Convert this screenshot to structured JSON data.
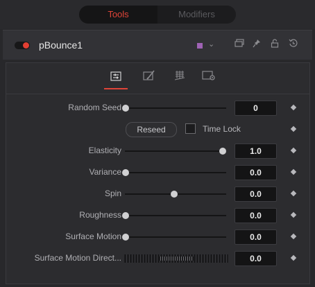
{
  "topbar": {
    "tabs": [
      {
        "label": "Tools",
        "active": true
      },
      {
        "label": "Modifiers",
        "active": false
      }
    ]
  },
  "header": {
    "tool_name": "pBounce1",
    "enabled": true,
    "swatch_color": "#9f63b5",
    "icons": [
      "chevron-down-icon",
      "windows-icon",
      "pin-icon",
      "lock-icon",
      "reset-icon"
    ]
  },
  "panel": {
    "tabs": [
      {
        "name": "controls-tab",
        "icon": "sliders-icon",
        "active": true
      },
      {
        "name": "style-tab",
        "icon": "brush-icon",
        "active": false
      },
      {
        "name": "region-tab",
        "icon": "grid-icon",
        "active": false
      },
      {
        "name": "settings-tab",
        "icon": "gear-icon",
        "active": false
      }
    ],
    "random_seed": {
      "label": "Random Seed",
      "value": "0",
      "level": 0.0
    },
    "reseed": {
      "label": "Reseed"
    },
    "time_lock": {
      "label": "Time Lock",
      "checked": false
    },
    "elasticity": {
      "label": "Elasticity",
      "value": "1.0",
      "level": 1.0
    },
    "variance": {
      "label": "Variance",
      "value": "0.0",
      "level": 0.0
    },
    "spin": {
      "label": "Spin",
      "value": "0.0",
      "level": 0.5
    },
    "roughness": {
      "label": "Roughness",
      "value": "0.0",
      "level": 0.0
    },
    "surface_motion": {
      "label": "Surface Motion",
      "value": "0.0",
      "level": 0.0
    },
    "surface_motion_direction": {
      "label": "Surface Motion Direct...",
      "value": "0.0"
    }
  },
  "colors": {
    "accent": "#e04438",
    "background": "#28282b"
  }
}
